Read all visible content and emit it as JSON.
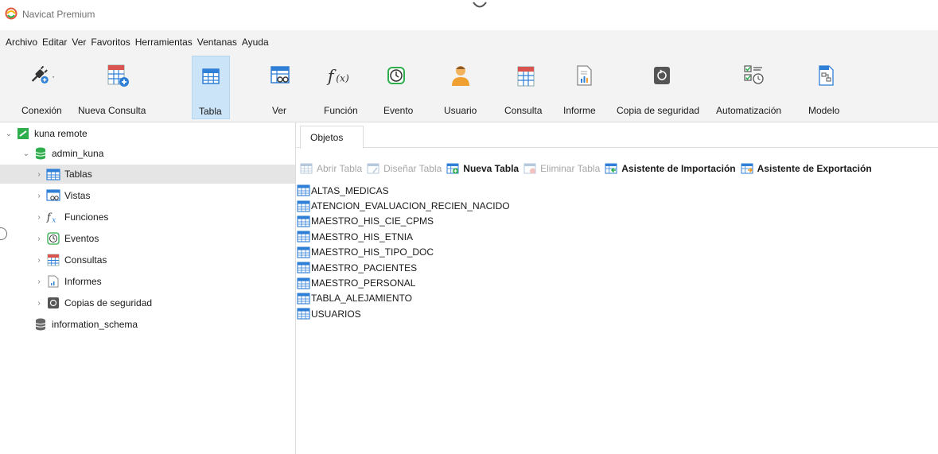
{
  "window": {
    "title": "Navicat Premium"
  },
  "menu": [
    "Archivo",
    "Editar",
    "Ver",
    "Favoritos",
    "Herramientas",
    "Ventanas",
    "Ayuda"
  ],
  "toolbar": {
    "connection": "Conexión",
    "new_query": "Nueva Consulta",
    "table": "Tabla",
    "view": "Ver",
    "function": "Función",
    "event": "Evento",
    "user": "Usuario",
    "query": "Consulta",
    "report": "Informe",
    "backup": "Copia de seguridad",
    "automation": "Automatización",
    "model": "Modelo"
  },
  "tree": {
    "connection": "kuna remote",
    "database": "admin_kuna",
    "items": [
      "Tablas",
      "Vistas",
      "Funciones",
      "Eventos",
      "Consultas",
      "Informes",
      "Copias de seguridad"
    ],
    "other_db": "information_schema"
  },
  "main": {
    "tab": "Objetos",
    "actions": {
      "open": "Abrir Tabla",
      "design": "Diseñar Tabla",
      "new": "Nueva Tabla",
      "delete": "Eliminar Tabla",
      "import": "Asistente de Importación",
      "export": "Asistente de Exportación"
    },
    "tables": [
      "ALTAS_MEDICAS",
      "ATENCION_EVALUACION_RECIEN_NACIDO",
      "MAESTRO_HIS_CIE_CPMS",
      "MAESTRO_HIS_ETNIA",
      "MAESTRO_HIS_TIPO_DOC",
      "MAESTRO_PACIENTES",
      "MAESTRO_PERSONAL",
      "TABLA_ALEJAMIENTO",
      "USUARIOS"
    ]
  },
  "colors": {
    "accent_blue": "#2f7fd6",
    "selection_bg": "#cce4f7",
    "tree_selected": "#e5e5e5",
    "toolbar_bg": "#f3f3f3",
    "disabled_text": "#a6a6a6",
    "green": "#2fae4e",
    "red": "#d9534f"
  }
}
